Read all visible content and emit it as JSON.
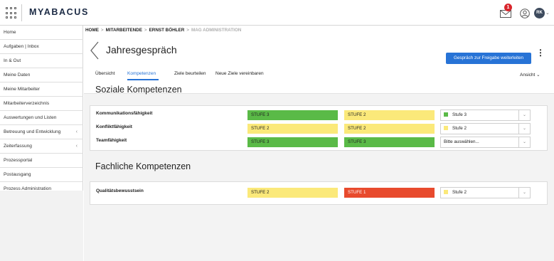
{
  "app": {
    "brand": "MYABACUS",
    "mail_count": "1",
    "avatar_initials": "RK"
  },
  "sidebar": {
    "items": [
      {
        "label": "Home",
        "chevron": ""
      },
      {
        "label": "Aufgaben | Inbox",
        "chevron": ""
      },
      {
        "label": "In & Out",
        "chevron": ""
      },
      {
        "label": "Meine Daten",
        "chevron": ""
      },
      {
        "label": "Meine Mitarbeiter",
        "chevron": ""
      },
      {
        "label": "Mitarbeiterverzeichnis",
        "chevron": ""
      },
      {
        "label": "Auswertungen und Listen",
        "chevron": ""
      },
      {
        "label": "Betreuung und Entwicklung",
        "chevron": "‹"
      },
      {
        "label": "Zeiterfassung",
        "chevron": "‹"
      },
      {
        "label": "Prozessportal",
        "chevron": ""
      },
      {
        "label": "Postausgang",
        "chevron": ""
      },
      {
        "label": "Prozess Administration",
        "chevron": ""
      }
    ]
  },
  "breadcrumb": {
    "home": "HOME",
    "level1": "MITARBEITENDE",
    "level2": "ERNST BÖHLER",
    "level3": "MAG ADMINISTRATION"
  },
  "page": {
    "title": "Jahresgespräch",
    "primary_button": "Gespräch zur Freigabe weiterleiten",
    "more_glyph": "⋮",
    "view_label": "Ansicht ⌄",
    "tabs": [
      "Übersicht",
      "Kompetenzen",
      "Ziele beurteilen",
      "Neue Ziele vereinbaren"
    ],
    "active_tab": "Kompetenzen"
  },
  "sections": {
    "social": {
      "title": "Soziale Kompetenzen",
      "rows": [
        {
          "label": "Kommunikationsfähigkeit",
          "employee": "STUFE 3",
          "employee_color": "green",
          "manager": "STUFE 2",
          "manager_color": "yellow",
          "selected": "Stufe 3",
          "selected_color": "#5aba47"
        },
        {
          "label": "Konfliktfähigkeit",
          "employee": "STUFE 2",
          "employee_color": "yellow",
          "manager": "STUFE 2",
          "manager_color": "yellow",
          "selected": "Stufe 2",
          "selected_color": "#fbe97a"
        },
        {
          "label": "Teamfähigkeit",
          "employee": "STUFE 3",
          "employee_color": "green",
          "manager": "STUFE 3",
          "manager_color": "green",
          "selected": "Bitte auswählen...",
          "selected_color": ""
        }
      ]
    },
    "professional": {
      "title": "Fachliche Kompetenzen",
      "rows": [
        {
          "label": "Qualitätsbewusstsein",
          "employee": "STUFE 2",
          "employee_color": "yellow",
          "manager": "STUFE 1",
          "manager_color": "red",
          "selected": "Stufe 2",
          "selected_color": "#fbe97a"
        }
      ]
    }
  },
  "icons": {
    "apps": "apps-grid-icon",
    "mail": "mail-icon",
    "user": "user-icon",
    "back": "chevron-left-icon",
    "caret": "chevron-down-icon"
  }
}
